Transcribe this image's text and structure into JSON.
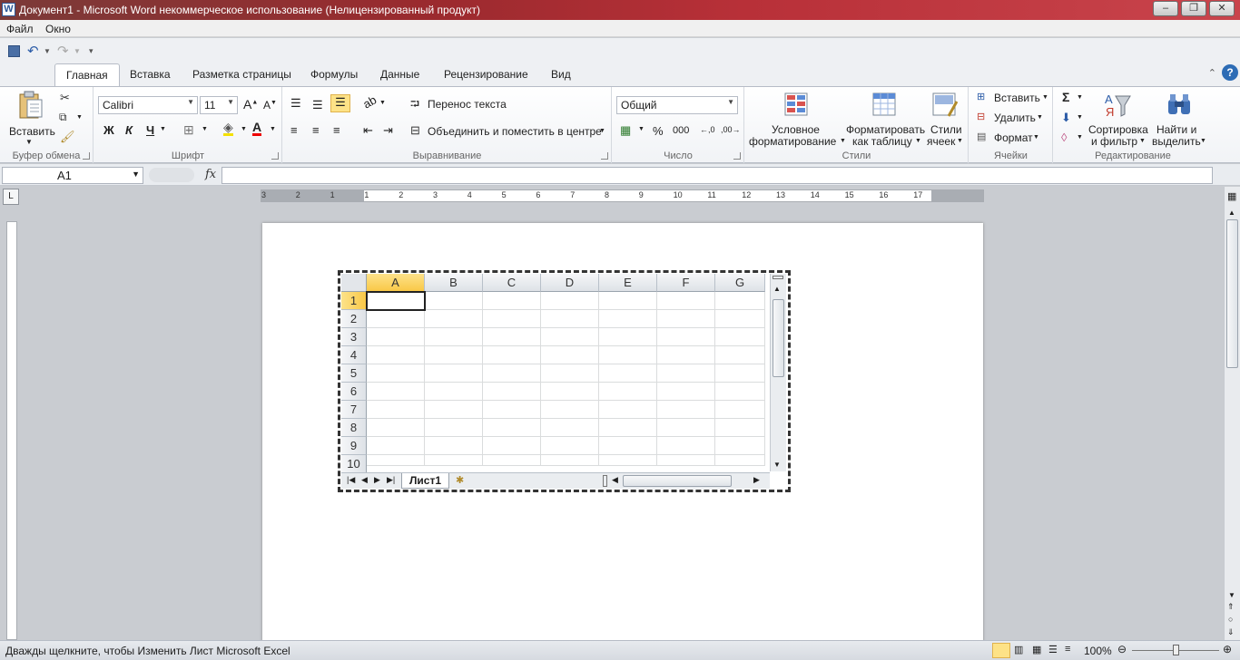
{
  "titlebar": {
    "app_icon": "W",
    "title": "Документ1 - Microsoft Word некоммерческое использование (Нелицензированный продукт)",
    "minimize": "–",
    "maximize": "❐",
    "close": "✕"
  },
  "menu": {
    "file": "Файл",
    "window": "Окно"
  },
  "tabs": {
    "home": "Главная",
    "insert": "Вставка",
    "layout": "Разметка страницы",
    "formulas": "Формулы",
    "data": "Данные",
    "review": "Рецензирование",
    "view": "Вид"
  },
  "ribbon": {
    "clipboard": {
      "label": "Буфер обмена",
      "paste": "Вставить"
    },
    "font": {
      "label": "Шрифт",
      "name": "Calibri",
      "size": "11",
      "bold": "Ж",
      "italic": "К",
      "underline": "Ч"
    },
    "alignment": {
      "label": "Выравнивание",
      "wrap_text": "Перенос текста",
      "merge_center": "Объединить и поместить в центре"
    },
    "number": {
      "label": "Число",
      "format": "Общий",
      "percent": "%",
      "thousands": "000"
    },
    "styles": {
      "label": "Стили",
      "conditional_1": "Условное",
      "conditional_2": "форматирование",
      "format_table_1": "Форматировать",
      "format_table_2": "как таблицу",
      "cell_styles_1": "Стили",
      "cell_styles_2": "ячеек"
    },
    "cells": {
      "label": "Ячейки",
      "insert": "Вставить",
      "delete": "Удалить",
      "format": "Формат"
    },
    "editing": {
      "label": "Редактирование",
      "sort_1": "Сортировка",
      "sort_2": "и фильтр",
      "find_1": "Найти и",
      "find_2": "выделить"
    }
  },
  "formula_bar": {
    "name_box": "A1",
    "fx": "fx",
    "value": ""
  },
  "ruler": {
    "numbers": [
      "3",
      "2",
      "1",
      "1",
      "2",
      "3",
      "4",
      "5",
      "6",
      "7",
      "8",
      "9",
      "10",
      "11",
      "12",
      "13",
      "14",
      "15",
      "16",
      "17"
    ]
  },
  "sheet": {
    "columns": [
      "A",
      "B",
      "C",
      "D",
      "E",
      "F",
      "G"
    ],
    "rows": [
      "1",
      "2",
      "3",
      "4",
      "5",
      "6",
      "7",
      "8",
      "9",
      "10"
    ],
    "active_cell": "A1",
    "tab": "Лист1"
  },
  "status": {
    "message": "Дважды щелкните, чтобы Изменить Лист Microsoft Excel",
    "zoom": "100%"
  }
}
